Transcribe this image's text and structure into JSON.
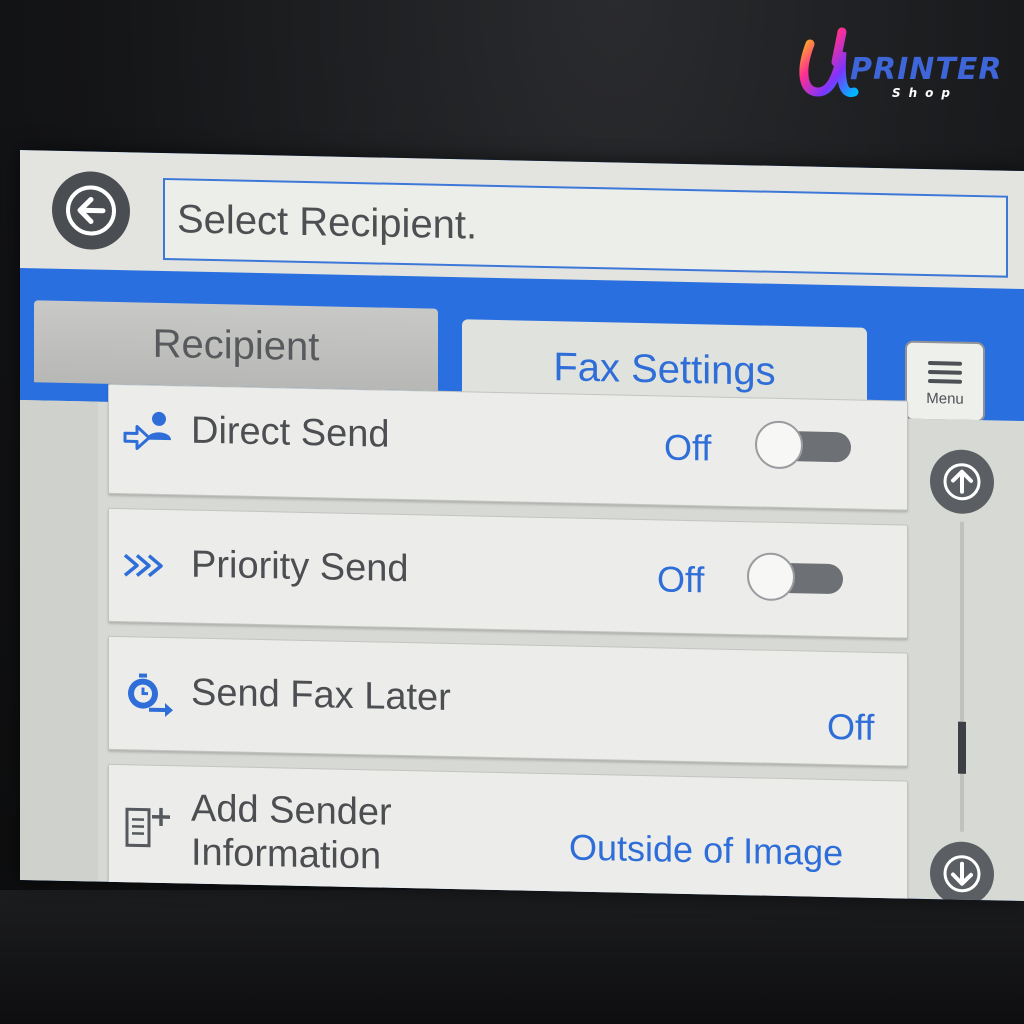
{
  "watermark": {
    "brand": "PRINTER",
    "sub": "Shop"
  },
  "header": {
    "title": "Select Recipient."
  },
  "tabs": [
    {
      "label": "Recipient",
      "active": false
    },
    {
      "label": "Fax Settings",
      "active": true
    }
  ],
  "menu": {
    "label": "Menu"
  },
  "settings": [
    {
      "label": "Direct Send",
      "value": "Off",
      "control": "toggle",
      "icon": "direct-send-icon"
    },
    {
      "label": "Priority Send",
      "value": "Off",
      "control": "toggle",
      "icon": "priority-send-icon"
    },
    {
      "label": "Send Fax Later",
      "value": "Off",
      "control": "value",
      "icon": "clock-arrow-icon"
    },
    {
      "label_line1": "Add Sender",
      "label_line2": "Information",
      "value": "Outside of Image",
      "control": "value",
      "icon": "document-add-icon"
    }
  ],
  "colors": {
    "accent": "#2f6ed8",
    "header_bg": "#e3e4df",
    "row_bg": "#ecedea"
  }
}
